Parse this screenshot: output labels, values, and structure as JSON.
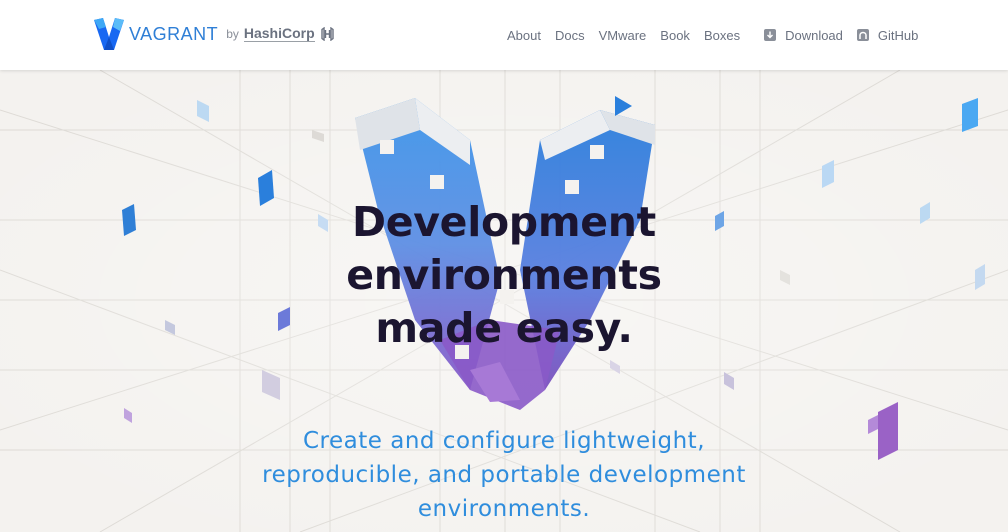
{
  "brand": {
    "name": "VAGRANT",
    "by": "by",
    "company": "HashiCorp",
    "logo_icon": "vagrant-v-logo",
    "company_icon": "hashicorp-icon"
  },
  "nav": {
    "items": [
      "About",
      "Docs",
      "VMware",
      "Book",
      "Boxes"
    ],
    "download": {
      "label": "Download",
      "icon": "download-icon"
    },
    "github": {
      "label": "GitHub",
      "icon": "github-icon"
    }
  },
  "hero": {
    "headline": [
      "Development",
      "environments",
      "made easy."
    ],
    "subhead": [
      "Create and configure lightweight,",
      "reproducible, and portable development",
      "environments."
    ]
  },
  "colors": {
    "accent_blue": "#2f8ddd",
    "headline": "#1b1530",
    "purple": "#8a5ac8",
    "background": "#f4f2ef"
  }
}
